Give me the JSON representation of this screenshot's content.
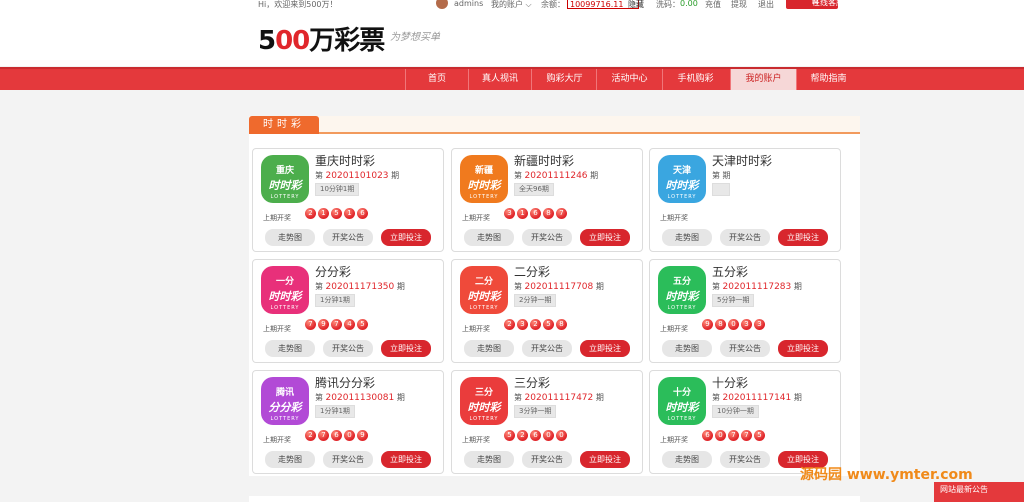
{
  "topbar": {
    "greeting": "Hi，欢迎来到500万！",
    "username": "admins",
    "my_account": "我的账户",
    "balance_label": "余额：",
    "balance_value": "10099716.11",
    "hide": "隐藏",
    "rebate_label": "洗码：",
    "rebate_value": "0.00",
    "recharge": "充值",
    "withdraw": "提现",
    "logout": "退出",
    "customer_service": "在线客服"
  },
  "header": {
    "logo_prefix": "5",
    "logo_zero": "00",
    "logo_suffix": "万彩票",
    "slogan": "为梦想买单"
  },
  "nav": [
    "首页",
    "真人视讯",
    "购彩大厅",
    "活动中心",
    "手机购彩",
    "我的账户",
    "帮助指南"
  ],
  "nav_active": "我的账户",
  "section": {
    "title": "时时彩"
  },
  "common": {
    "issue_prefix": "第",
    "issue_suffix": "期",
    "last_draw_label": "上期开奖",
    "trend_btn": "走势图",
    "notice_btn": "开奖公告",
    "bet_btn": "立即投注"
  },
  "games": [
    {
      "name": "重庆时时彩",
      "issue": "20201101023",
      "tag": "10分钟1期",
      "balls": [
        "2",
        "1",
        "5",
        "1",
        "6"
      ],
      "icon_top": "重庆",
      "icon_mid": "时时彩",
      "icon_bot": "LOTTERY",
      "color": "#4cae4c"
    },
    {
      "name": "新疆时时彩",
      "issue": "20201111246",
      "tag": "全天96期",
      "balls": [
        "3",
        "1",
        "6",
        "8",
        "7"
      ],
      "icon_top": "新疆",
      "icon_mid": "时时彩",
      "icon_bot": "LOTTERY",
      "color": "#f07a1e"
    },
    {
      "name": "天津时时彩",
      "issue": "",
      "tag": "",
      "balls": [],
      "icon_top": "天津",
      "icon_mid": "时时彩",
      "icon_bot": "LOTTERY",
      "color": "#3aa6e0"
    },
    {
      "name": "分分彩",
      "issue": "202011171350",
      "tag": "1分钟1期",
      "balls": [
        "7",
        "9",
        "7",
        "4",
        "5"
      ],
      "icon_top": "一分",
      "icon_mid": "时时彩",
      "icon_bot": "LOTTERY",
      "color": "#e8307a"
    },
    {
      "name": "二分彩",
      "issue": "202011117708",
      "tag": "2分钟一期",
      "balls": [
        "2",
        "3",
        "2",
        "5",
        "8"
      ],
      "icon_top": "二分",
      "icon_mid": "时时彩",
      "icon_bot": "LOTTERY",
      "color": "#ef4a3a"
    },
    {
      "name": "五分彩",
      "issue": "202011117283",
      "tag": "5分钟一期",
      "balls": [
        "9",
        "8",
        "0",
        "3",
        "3"
      ],
      "icon_top": "五分",
      "icon_mid": "时时彩",
      "icon_bot": "LOTTERY",
      "color": "#2bbd5a"
    },
    {
      "name": "腾讯分分彩",
      "issue": "202011130081",
      "tag": "1分钟1期",
      "balls": [
        "2",
        "7",
        "6",
        "0",
        "9"
      ],
      "icon_top": "腾讯",
      "icon_mid": "分分彩",
      "icon_bot": "LOTTERY",
      "color": "#b24ad6"
    },
    {
      "name": "三分彩",
      "issue": "202011117472",
      "tag": "3分钟一期",
      "balls": [
        "5",
        "2",
        "6",
        "0",
        "0"
      ],
      "icon_top": "三分",
      "icon_mid": "时时彩",
      "icon_bot": "LOTTERY",
      "color": "#ea3c3c"
    },
    {
      "name": "十分彩",
      "issue": "202011117141",
      "tag": "10分钟一期",
      "balls": [
        "6",
        "0",
        "7",
        "7",
        "5"
      ],
      "icon_top": "十分",
      "icon_mid": "时时彩",
      "icon_bot": "LOTTERY",
      "color": "#2bbd5a"
    }
  ],
  "footer": {
    "notice": "网站最新公告",
    "watermark": "源码园 www.ymter.com"
  }
}
